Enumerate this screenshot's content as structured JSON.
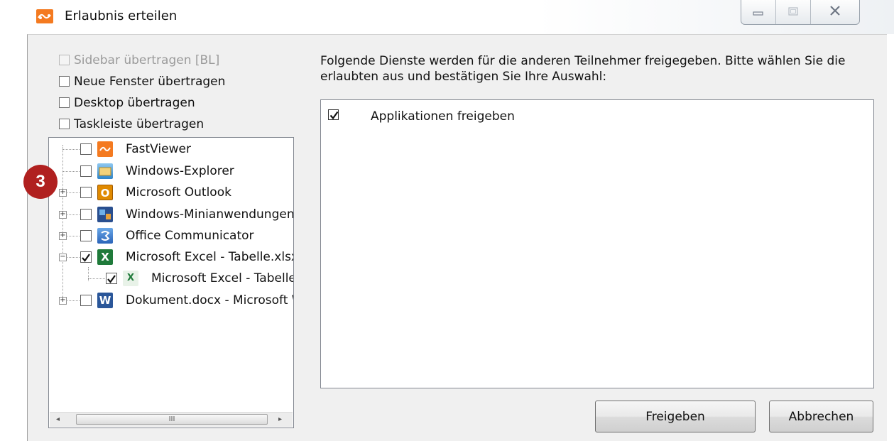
{
  "window": {
    "title": "Erlaubnis erteilen",
    "controls": {
      "minimize_icon": "minimize-icon",
      "maximize_icon": "maximize-icon",
      "close_icon": "close-icon"
    }
  },
  "options": [
    {
      "label": "Sidebar übertragen [BL]",
      "checked": false,
      "disabled": true
    },
    {
      "label": "Neue Fenster übertragen",
      "checked": false,
      "disabled": false
    },
    {
      "label": "Desktop übertragen",
      "checked": false,
      "disabled": false
    },
    {
      "label": "Taskleiste übertragen",
      "checked": false,
      "disabled": false
    }
  ],
  "tree": {
    "items": [
      {
        "label": "FastViewer",
        "checked": false,
        "icon": "fastviewer-icon",
        "expander": "none"
      },
      {
        "label": "Windows-Explorer",
        "checked": false,
        "icon": "windows-explorer-icon",
        "expander": "none"
      },
      {
        "label": "Microsoft Outlook",
        "checked": false,
        "icon": "outlook-icon",
        "expander": "+"
      },
      {
        "label": "Windows-Minianwendungen",
        "checked": false,
        "icon": "gadgets-icon",
        "expander": "+"
      },
      {
        "label": "Office Communicator",
        "checked": false,
        "icon": "communicator-icon",
        "expander": "+"
      },
      {
        "label": "Microsoft Excel - Tabelle.xlsx",
        "checked": true,
        "icon": "excel-icon",
        "expander": "−"
      },
      {
        "label": "Microsoft Excel - Tabelle.xlsx",
        "checked": true,
        "icon": "excel-sheet-icon",
        "expander": "child"
      },
      {
        "label": "Dokument.docx - Microsoft Word",
        "checked": false,
        "icon": "word-icon",
        "expander": "+"
      }
    ],
    "scrollbar": {
      "left_arrow": "◂",
      "right_arrow": "▸",
      "grip": "III"
    }
  },
  "description": "Folgende Dienste werden für die anderen Teilnehmer freigegeben. Bitte wählen Sie die erlaubten aus und bestätigen Sie Ihre Auswahl:",
  "services": [
    {
      "label": "Applikationen freigeben",
      "checked": true
    }
  ],
  "buttons": {
    "share": "Freigeben",
    "cancel": "Abbrechen"
  },
  "badge": "3",
  "colors": {
    "accent_orange": "#f47a20",
    "badge_red": "#b0201f",
    "excel_green": "#1f7a3a",
    "word_blue": "#2a5699",
    "outlook_orange": "#e08a00"
  }
}
